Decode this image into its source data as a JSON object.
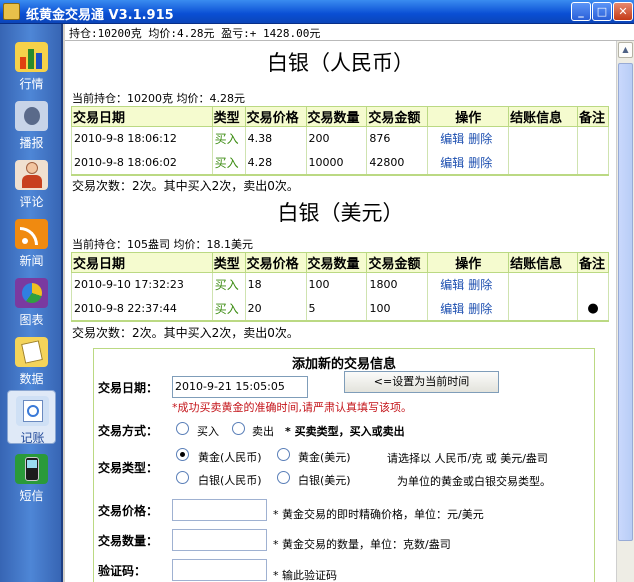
{
  "window": {
    "title": "纸黄金交易通 V3.1.915",
    "min": "_",
    "max": "□",
    "close": "✕"
  },
  "sidebar": {
    "items": [
      {
        "label": "行情",
        "icon": "chart-bar-icon",
        "color": "#e04010"
      },
      {
        "label": "播报",
        "icon": "broadcast-icon",
        "color": "#4a6aa0"
      },
      {
        "label": "评论",
        "icon": "user-comment-icon",
        "color": "#c84020"
      },
      {
        "label": "新闻",
        "icon": "rss-icon",
        "color": "#f08a10"
      },
      {
        "label": "图表",
        "icon": "pie-chart-icon",
        "color": "#7a3aa0"
      },
      {
        "label": "数据",
        "icon": "data-icon",
        "color": "#e0b020"
      },
      {
        "label": "记账",
        "icon": "ledger-icon",
        "color": "#3a7ad8"
      },
      {
        "label": "短信",
        "icon": "phone-sms-icon",
        "color": "#2a9a3a"
      }
    ]
  },
  "status": {
    "text": "持仓:10200克 均价:4.28元 盈亏:+ 1428.00元"
  },
  "table_headers": [
    "交易日期",
    "类型",
    "交易价格",
    "交易数量",
    "交易金额",
    "操作",
    "结账信息",
    "备注"
  ],
  "op_labels": {
    "edit": "编辑",
    "delete": "删除"
  },
  "silver_rmb": {
    "title": "白银（人民币）",
    "holding": "当前持仓：10200克 均价：4.28元",
    "rows": [
      {
        "date": "2010-9-8 18:06:12",
        "type": "买入",
        "price": "4.38",
        "qty": "200",
        "amount": "876",
        "note": ""
      },
      {
        "date": "2010-9-8 18:06:02",
        "type": "买入",
        "price": "4.28",
        "qty": "10000",
        "amount": "42800",
        "note": ""
      }
    ],
    "summary": "交易次数：2次。其中买入2次，卖出0次。"
  },
  "silver_usd": {
    "title": "白银（美元）",
    "holding": "当前持仓：105盎司 均价：18.1美元",
    "rows": [
      {
        "date": "2010-9-10 17:32:23",
        "type": "买入",
        "price": "18",
        "qty": "100",
        "amount": "1800",
        "note": ""
      },
      {
        "date": "2010-9-8 22:37:44",
        "type": "买入",
        "price": "20",
        "qty": "5",
        "amount": "100",
        "note": "●"
      }
    ],
    "summary": "交易次数：2次。其中买入2次，卖出0次。"
  },
  "form": {
    "title": "添加新的交易信息",
    "date_label": "交易日期：",
    "date_value": "2010-9-21 15:05:05",
    "set_now_button": "<=设置为当前时间",
    "date_hint": "*成功买卖黄金的准确时间,请严肃认真填写该项。",
    "method_label": "交易方式：",
    "method_buy": "买入",
    "method_sell": "卖出",
    "method_hint": "* 买卖类型，买入或卖出",
    "kind_label": "交易类型：",
    "kind_gold_rmb": "黄金(人民币)",
    "kind_gold_usd": "黄金(美元)",
    "kind_silver_rmb": "白银(人民币)",
    "kind_silver_usd": "白银(美元)",
    "kind_hint_1": "请选择以 人民币/克 或 美元/盎司",
    "kind_hint_2": "为单位的黄金或白银交易类型。",
    "price_label": "交易价格：",
    "price_value": "",
    "price_hint": "* 黄金交易的即时精确价格，单位：元/美元",
    "qty_label": "交易数量：",
    "qty_value": "",
    "qty_hint": "* 黄金交易的数量，单位：克数/盎司",
    "code_label": "验证码：",
    "code_value": "",
    "code_hint": "* 输此验证码"
  }
}
